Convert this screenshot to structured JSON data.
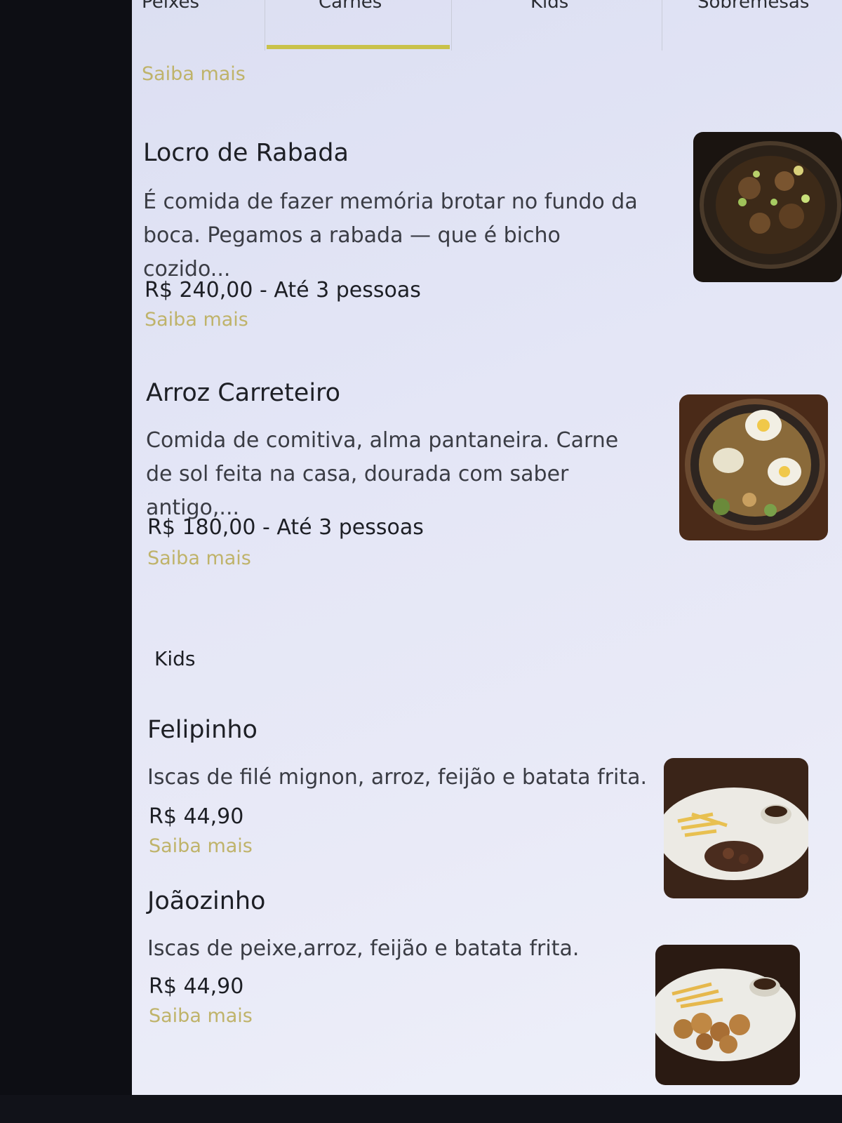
{
  "tabs": [
    {
      "label": "Peixes"
    },
    {
      "label": "Carnes"
    },
    {
      "label": "Kids"
    },
    {
      "label": "Sobremesas"
    }
  ],
  "top_link": "Saiba mais",
  "carnes_items": [
    {
      "title": "Locro de Rabada",
      "description": "É comida de fazer memória brotar no fundo da boca. Pegamos a rabada — que é bicho cozido...",
      "price": "R$ 240,00 - Até 3 pessoas",
      "link": "Saiba mais",
      "image": "locro-de-rabada-photo"
    },
    {
      "title": "Arroz Carreteiro",
      "description": "Comida de comitiva, alma pantaneira. Carne de sol feita na casa, dourada com saber antigo,...",
      "price": "R$ 180,00 - Até 3 pessoas",
      "link": "Saiba mais",
      "image": "arroz-carreteiro-photo"
    }
  ],
  "kids_section": {
    "title": "Kids",
    "items": [
      {
        "title": "Felipinho",
        "description": "Iscas de filé mignon, arroz, feijão e batata frita.",
        "price": "R$ 44,90",
        "link": "Saiba mais",
        "image": "felipinho-photo"
      },
      {
        "title": "Joãozinho",
        "description": "Iscas de peixe,arroz, feijão e batata frita.",
        "price": "R$ 44,90",
        "link": "Saiba mais",
        "image": "joaozinho-photo"
      }
    ]
  },
  "colors": {
    "accent": "#c9c24a",
    "link": "#bfb36a",
    "background": "#e4e6f6"
  }
}
